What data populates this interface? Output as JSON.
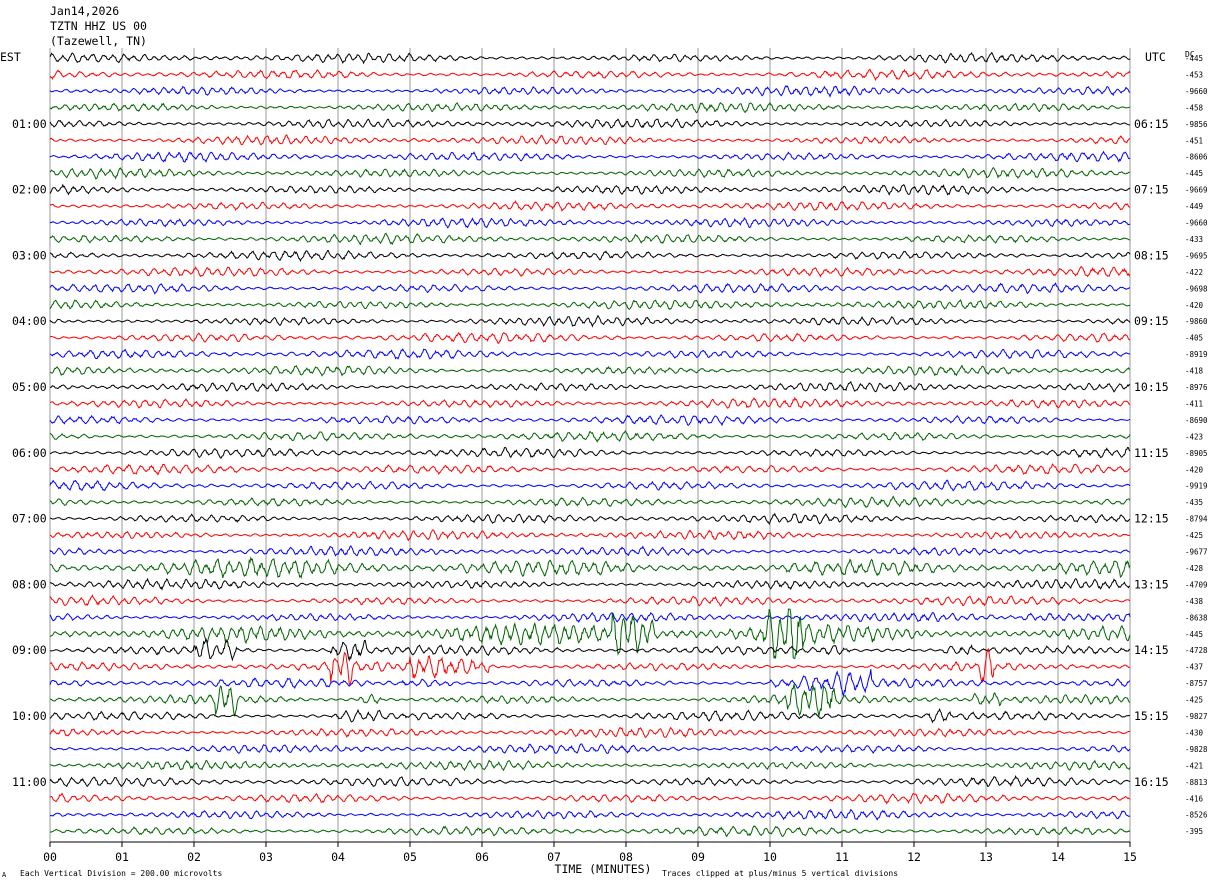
{
  "header": {
    "date": "Jan14,2026",
    "station": "TZTN HHZ US 00",
    "location": "(Tazewell, TN)"
  },
  "left_zone": "EST",
  "right_zone": "UTC",
  "dc_label": "DC",
  "footer": {
    "scale": "Each Vertical Division =  200.00 microvolts",
    "clip": "Traces clipped at plus/minus 5 vertical divisions"
  },
  "chart_data": {
    "type": "line",
    "title": "",
    "xlabel": "TIME (MINUTES)",
    "ylabel": "",
    "xlim": [
      0,
      15
    ],
    "x_ticks": [
      "00",
      "01",
      "02",
      "03",
      "04",
      "05",
      "06",
      "07",
      "08",
      "09",
      "10",
      "11",
      "12",
      "13",
      "14",
      "15"
    ],
    "y_left_labels": [
      "01:00",
      "02:00",
      "03:00",
      "04:00",
      "05:00",
      "06:00",
      "07:00",
      "08:00",
      "09:00",
      "10:00",
      "11:00"
    ],
    "y_right_labels": [
      "06:15",
      "07:15",
      "08:15",
      "09:15",
      "10:15",
      "11:15",
      "12:15",
      "13:15",
      "14:15",
      "15:15",
      "16:15"
    ],
    "trace_colors": [
      "#000000",
      "#ff0000",
      "#0000ff",
      "#006400"
    ],
    "num_traces": 48,
    "dc_offsets": [
      "-445",
      "-453",
      "-9660",
      "-458",
      "-9856",
      "-451",
      "-8606",
      "-445",
      "-9669",
      "-449",
      "-9660",
      "-433",
      "-9695",
      "-422",
      "-9698",
      "-420",
      "-9860",
      "-405",
      "-8919",
      "-418",
      "-8976",
      "-411",
      "-8690",
      "-423",
      "-8905",
      "-420",
      "-9919",
      "-435",
      "-8794",
      "-425",
      "-9677",
      "-428",
      "-4709",
      "-438",
      "-8638",
      "-445",
      "-4728",
      "-437",
      "-8757",
      "-425",
      "-9827",
      "-430",
      "-9828",
      "-421",
      "-8813",
      "-416",
      "-8526",
      "-395"
    ],
    "events": [
      {
        "trace": 31,
        "start": 0.0,
        "end": 15.0,
        "level": 1.0
      },
      {
        "trace": 34,
        "start": 13.5,
        "end": 15.0,
        "level": 2.0
      },
      {
        "trace": 35,
        "start": 0.0,
        "end": 15.0,
        "level": 1.2
      },
      {
        "trace": 35,
        "start": 7.8,
        "end": 8.4,
        "level": 2.6
      },
      {
        "trace": 35,
        "start": 9.9,
        "end": 10.5,
        "level": 2.6
      },
      {
        "trace": 36,
        "start": 2.0,
        "end": 2.6,
        "level": 2.5
      },
      {
        "trace": 36,
        "start": 3.9,
        "end": 4.4,
        "level": 3.2
      },
      {
        "trace": 36,
        "start": 10.7,
        "end": 11.1,
        "level": 2.4
      },
      {
        "trace": 36,
        "start": 12.4,
        "end": 12.8,
        "level": 2.6
      },
      {
        "trace": 37,
        "start": 3.9,
        "end": 4.2,
        "level": 3.0
      },
      {
        "trace": 37,
        "start": 5.0,
        "end": 5.8,
        "level": 2.2
      },
      {
        "trace": 37,
        "start": 5.8,
        "end": 6.1,
        "level": 3.0
      },
      {
        "trace": 37,
        "start": 12.9,
        "end": 13.1,
        "level": 2.8
      },
      {
        "trace": 38,
        "start": 4.9,
        "end": 5.6,
        "level": 2.0
      },
      {
        "trace": 38,
        "start": 10.0,
        "end": 11.4,
        "level": 2.2
      },
      {
        "trace": 39,
        "start": 2.3,
        "end": 2.6,
        "level": 2.8
      },
      {
        "trace": 39,
        "start": 4.3,
        "end": 4.6,
        "level": 3.0
      },
      {
        "trace": 39,
        "start": 10.2,
        "end": 10.9,
        "level": 2.6
      },
      {
        "trace": 39,
        "start": 12.8,
        "end": 13.2,
        "level": 2.0
      },
      {
        "trace": 40,
        "start": 3.9,
        "end": 4.6,
        "level": 1.8
      },
      {
        "trace": 40,
        "start": 12.2,
        "end": 12.5,
        "level": 1.6
      }
    ]
  }
}
